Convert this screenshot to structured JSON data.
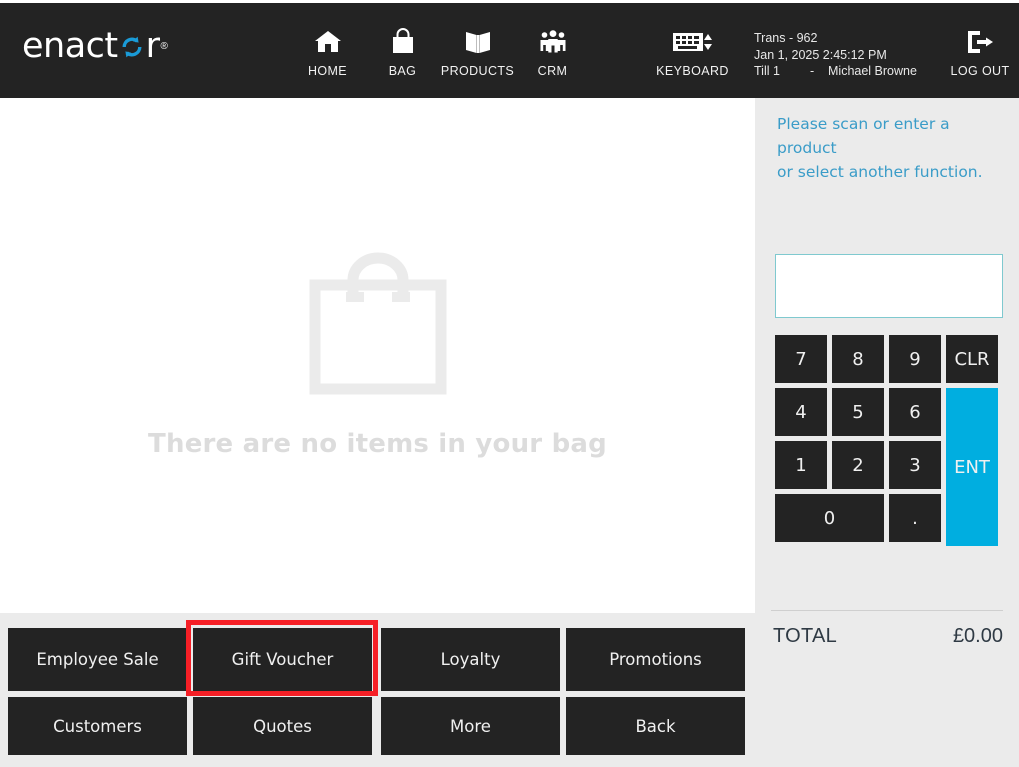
{
  "app": {
    "brand": "enactor",
    "brand_tm": "®",
    "accent_color": "#00AEE0",
    "header_bg": "#232323",
    "panel_bg": "#ebebeb",
    "highlight_color": "#f61f26"
  },
  "header": {
    "nav": [
      {
        "label": "HOME",
        "icon": "home-icon"
      },
      {
        "label": "BAG",
        "icon": "shopping-bag-icon"
      },
      {
        "label": "PRODUCTS",
        "icon": "open-book-icon"
      },
      {
        "label": "CRM",
        "icon": "people-group-icon"
      }
    ],
    "keyboard": {
      "label": "KEYBOARD",
      "icon": "keyboard-icon"
    },
    "transaction": {
      "trans": "Trans - 962",
      "datetime": "Jan 1, 2025 2:45:12 PM",
      "till": "Till 1",
      "separator": "-",
      "operator": "Michael Browne"
    },
    "logout": {
      "label": "LOG OUT",
      "icon": "logout-icon"
    }
  },
  "main": {
    "empty_bag_icon": "shopping-bag-outline-icon",
    "empty_bag_text": "There are no items in your bag"
  },
  "right_panel": {
    "prompt_line1": "Please scan or enter a product",
    "prompt_line2": "or select another function.",
    "entry_value": "",
    "entry_placeholder": "",
    "keypad": [
      {
        "label": "7",
        "type": "digit"
      },
      {
        "label": "8",
        "type": "digit"
      },
      {
        "label": "9",
        "type": "digit"
      },
      {
        "label": "CLR",
        "type": "clear"
      },
      {
        "label": "4",
        "type": "digit"
      },
      {
        "label": "5",
        "type": "digit"
      },
      {
        "label": "6",
        "type": "digit"
      },
      {
        "label": "1",
        "type": "digit"
      },
      {
        "label": "2",
        "type": "digit"
      },
      {
        "label": "3",
        "type": "digit"
      },
      {
        "label": "ENT",
        "type": "enter"
      },
      {
        "label": "0",
        "type": "digit"
      },
      {
        "label": ".",
        "type": "decimal"
      }
    ],
    "total_label": "TOTAL",
    "total_value": "£0.00"
  },
  "footer": {
    "buttons": [
      {
        "label": "Employee Sale",
        "highlighted": false
      },
      {
        "label": "Gift Voucher",
        "highlighted": true
      },
      {
        "label": "Loyalty",
        "highlighted": false
      },
      {
        "label": "Promotions",
        "highlighted": false
      },
      {
        "label": "Customers",
        "highlighted": false
      },
      {
        "label": "Quotes",
        "highlighted": false
      },
      {
        "label": "More",
        "highlighted": false
      },
      {
        "label": "Back",
        "highlighted": false
      }
    ]
  }
}
